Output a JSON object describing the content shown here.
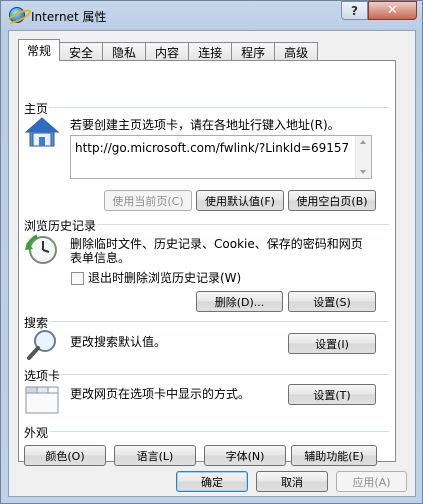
{
  "window": {
    "title": "Internet 属性",
    "help_label": "?",
    "close_label": "✕"
  },
  "tabs": [
    "常规",
    "安全",
    "隐私",
    "内容",
    "连接",
    "程序",
    "高级"
  ],
  "home": {
    "title": "主页",
    "description": "若要创建主页选项卡，请在各地址行键入地址(R)。",
    "url": "http://go.microsoft.com/fwlink/?LinkId=69157",
    "use_current": "使用当前页(C)",
    "use_default": "使用默认值(F)",
    "use_blank": "使用空白页(B)"
  },
  "history": {
    "title": "浏览历史记录",
    "description_line1": "删除临时文件、历史记录、Cookie、保存的密码和网页",
    "description_line2": "表单信息。",
    "checkbox_label": "退出时删除浏览历史记录(W)",
    "checkbox_checked": false,
    "delete_button": "删除(D)...",
    "settings_button": "设置(S)"
  },
  "search": {
    "title": "搜索",
    "description": "更改搜索默认值。",
    "settings_button": "设置(I)"
  },
  "tabs_section": {
    "title": "选项卡",
    "description": "更改网页在选项卡中显示的方式。",
    "settings_button": "设置(T)"
  },
  "appearance": {
    "title": "外观",
    "colors_button": "颜色(O)",
    "languages_button": "语言(L)",
    "fonts_button": "字体(N)",
    "accessibility_button": "辅助功能(E)"
  },
  "footer": {
    "ok": "确定",
    "cancel": "取消",
    "apply": "应用(A)"
  }
}
